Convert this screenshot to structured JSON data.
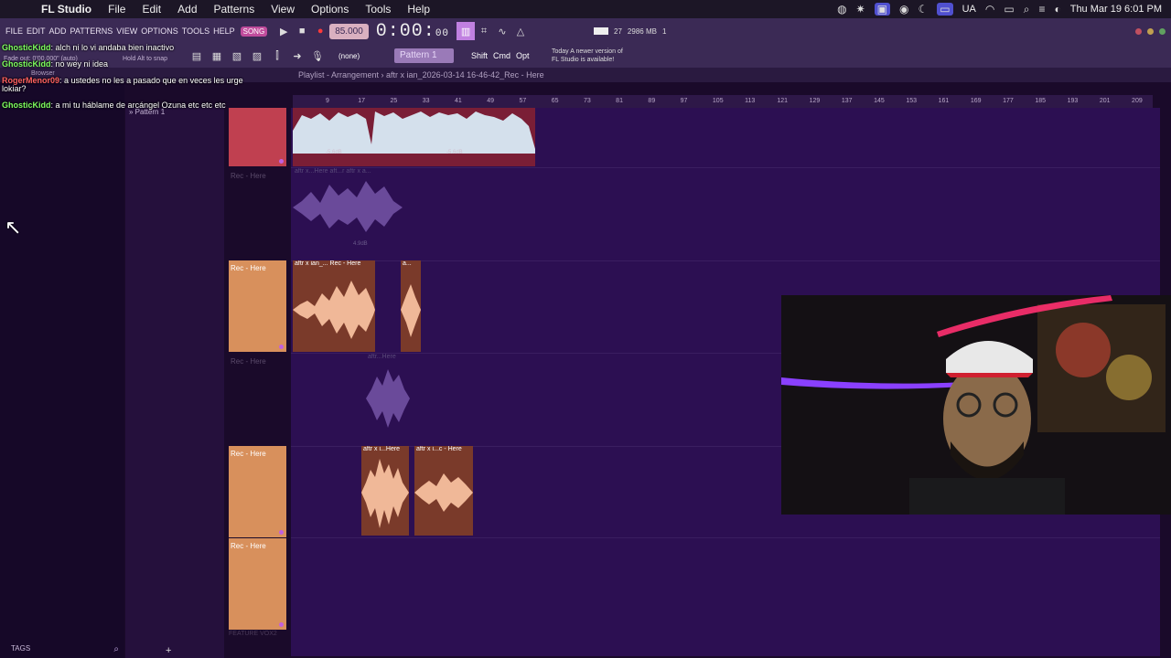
{
  "menubar": {
    "app": "FL Studio",
    "items": [
      "File",
      "Edit",
      "Add",
      "Patterns",
      "View",
      "Options",
      "Tools",
      "Help"
    ],
    "status_label": "UA",
    "datetime": "Thu Mar 19  6:01 PM"
  },
  "fl_menu": [
    "FILE",
    "EDIT",
    "ADD",
    "PATTERNS",
    "VIEW",
    "OPTIONS",
    "TOOLS",
    "HELP"
  ],
  "transport": {
    "pat_badge": "SONG",
    "tempo": "85.000",
    "time": "0:00",
    "time_ms": "00",
    "cpu": "27",
    "mem": "2986 MB",
    "voices": "1"
  },
  "toolbar2": {
    "hint_line1": "Fade out: 0'00.000\" (auto)",
    "hint_line2": "Hold Alt to snap",
    "none_label": "(none)",
    "pattern_label": "Pattern 1",
    "keys": [
      "Shift",
      "Cmd",
      "Opt"
    ],
    "notice_line1": "Today  A newer version of",
    "notice_line2": "FL Studio is available!"
  },
  "playlist": {
    "browser_label": "Browser",
    "title": "Playlist - Arrangement",
    "file": "aftr x ian_2026-03-14 16-46-42_Rec - Here",
    "ruler": [
      "9",
      "17",
      "25",
      "33",
      "41",
      "49",
      "57",
      "65",
      "73",
      "81",
      "89",
      "97",
      "105",
      "113",
      "121",
      "129",
      "137",
      "145",
      "153",
      "161",
      "169",
      "177",
      "185",
      "193",
      "201",
      "209"
    ]
  },
  "chat": [
    {
      "user": "GhosticKidd",
      "text": "alch ni lo vi andaba bien inactivo",
      "color": "green"
    },
    {
      "user": "GhosticKidd",
      "text": "no wey ni idea",
      "color": "green"
    },
    {
      "user": "RogerMenor09",
      "text": "a ustedes no les a pasado que en veces les urge lokiar?",
      "color": "red"
    },
    {
      "user": "GhosticKidd",
      "text": "a mi tu háblame de arcángel Ozuna etc etc etc",
      "color": "green"
    }
  ],
  "patterns": [
    "Pattern 1"
  ],
  "tracks": [
    {
      "label": "",
      "style": "red"
    },
    {
      "label": "Rec - Here",
      "style": "muted"
    },
    {
      "label": "Rec - Here",
      "style": "orange"
    },
    {
      "label": "Rec - Here",
      "style": "muted"
    },
    {
      "label": "Rec - Here",
      "style": "orange"
    },
    {
      "label": "Rec - Here",
      "style": "orange"
    }
  ],
  "clips": {
    "c1_db_a": "-5.6dB",
    "c1_db_b": "-5.6dB",
    "c2_title": "aftr x...Here  aft...r  aftr x a...",
    "c2_db": "4.9dB",
    "c3_title": "aftr x ian_... Rec - Here",
    "c3b_title": "a...",
    "c4_title": "aftr...Here",
    "c5_title": "aftr x i...Here",
    "c5b_title": "aftr x i...c - Here"
  },
  "bottom_track": "FEATURE VOX2",
  "browser_tags": "TAGS",
  "colors": {
    "accent": "#c080e0",
    "clip_salmon": "#f0b898",
    "clip_rose": "#d4e0ec",
    "arrange_bg": "#2c0f52"
  }
}
